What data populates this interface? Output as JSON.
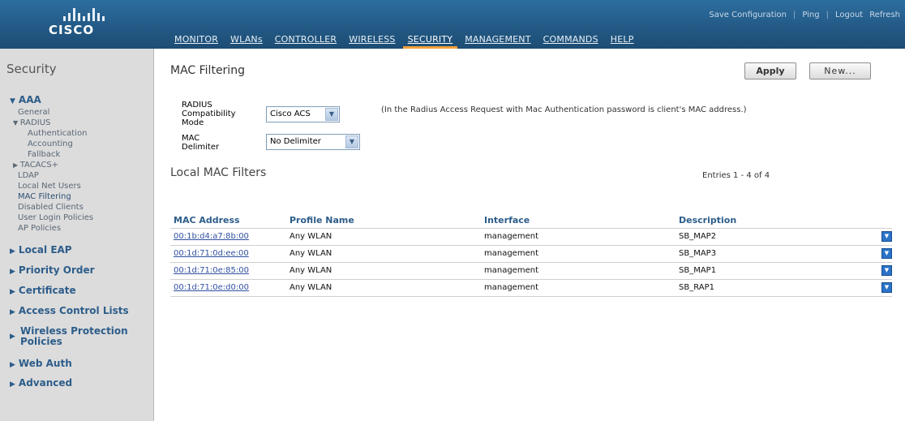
{
  "header": {
    "logo_text": "CISCO",
    "top_links": [
      "Save Configuration",
      "Ping",
      "Logout",
      "Refresh"
    ],
    "nav": [
      "MONITOR",
      "WLANs",
      "CONTROLLER",
      "WIRELESS",
      "SECURITY",
      "MANAGEMENT",
      "COMMANDS",
      "HELP"
    ],
    "active_nav": "SECURITY"
  },
  "sidebar": {
    "title": "Security",
    "aaa": {
      "label": "AAA",
      "general": "General",
      "radius": "RADIUS",
      "radius_items": [
        "Authentication",
        "Accounting",
        "Fallback"
      ],
      "tacacs": "TACACS+",
      "items": [
        "LDAP",
        "Local Net Users",
        "MAC Filtering",
        "Disabled Clients",
        "User Login Policies",
        "AP Policies"
      ]
    },
    "groups": [
      "Local EAP",
      "Priority Order",
      "Certificate",
      "Access Control Lists",
      "Wireless Protection Policies",
      "Web Auth",
      "Advanced"
    ]
  },
  "main": {
    "title": "MAC Filtering",
    "apply_label": "Apply",
    "new_label": "New...",
    "radius_label": "RADIUS Compatibility Mode",
    "radius_value": "Cisco ACS",
    "mac_label": "MAC Delimiter",
    "mac_value": "No Delimiter",
    "note": "(In the Radius Access Request with Mac Authentication password is client's MAC address.)",
    "section_title": "Local MAC Filters",
    "entries": "Entries 1 - 4 of 4",
    "columns": [
      "MAC Address",
      "Profile Name",
      "Interface",
      "Description"
    ],
    "rows": [
      {
        "mac": "00:1b:d4:a7:8b:00",
        "profile": "Any WLAN",
        "interface": "management",
        "description": "SB_MAP2"
      },
      {
        "mac": "00:1d:71:0d:ee:00",
        "profile": "Any WLAN",
        "interface": "management",
        "description": "SB_MAP3"
      },
      {
        "mac": "00:1d:71:0e:85:00",
        "profile": "Any WLAN",
        "interface": "management",
        "description": "SB_MAP1"
      },
      {
        "mac": "00:1d:71:0e:d0:00",
        "profile": "Any WLAN",
        "interface": "management",
        "description": "SB_RAP1"
      }
    ]
  },
  "colors": {
    "header_blue": "#235a86",
    "accent_orange": "#f3a13a",
    "sidebar_bg": "#dcdcdc",
    "link_blue": "#2d5d8a"
  }
}
